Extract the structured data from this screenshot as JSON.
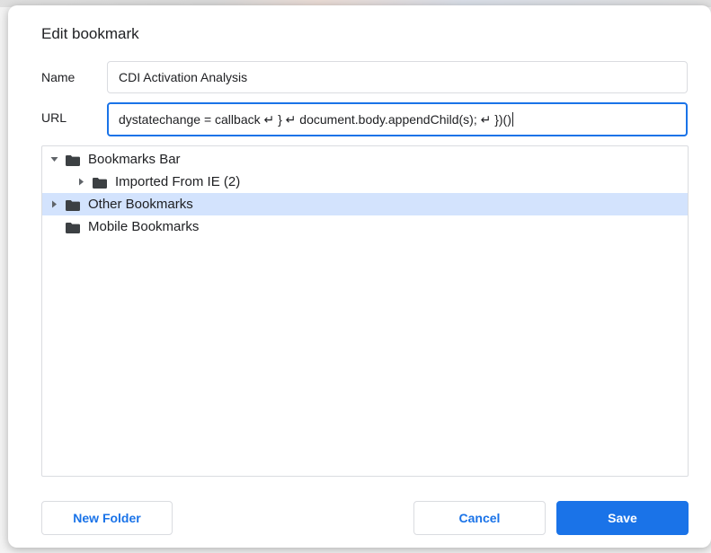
{
  "dialog": {
    "title": "Edit bookmark",
    "name_label": "Name",
    "name_value": "CDI Activation Analysis",
    "url_label": "URL",
    "url_value": "dystatechange = callback ↵     } ↵     document.body.appendChild(s); ↵ })()"
  },
  "tree": {
    "items": [
      {
        "label": "Bookmarks Bar",
        "expanded": true,
        "level": 0,
        "selected": false
      },
      {
        "label": "Imported From IE (2)",
        "expanded": false,
        "level": 1,
        "selected": false
      },
      {
        "label": "Other Bookmarks",
        "expanded": false,
        "level": 0,
        "selected": true
      },
      {
        "label": "Mobile Bookmarks",
        "expanded": null,
        "level": 0,
        "selected": false
      }
    ]
  },
  "buttons": {
    "new_folder": "New Folder",
    "cancel": "Cancel",
    "save": "Save"
  },
  "colors": {
    "accent": "#1a73e8",
    "selected_row": "#d3e3fd",
    "folder": "#3c4043"
  },
  "icons": {
    "expanded_twisty": "triangle-down-icon",
    "collapsed_twisty": "triangle-right-icon",
    "folder": "folder-icon"
  }
}
